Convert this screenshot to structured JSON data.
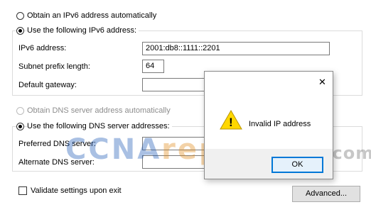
{
  "ipv6": {
    "auto_label": "Obtain an IPv6 address automatically",
    "manual_label": "Use the following IPv6 address:",
    "address_label": "IPv6 address:",
    "address_value": "2001:db8::1111::2201",
    "prefix_label": "Subnet prefix length:",
    "prefix_value": "64",
    "gateway_label": "Default gateway:",
    "gateway_value": ""
  },
  "dns": {
    "auto_label": "Obtain DNS server address automatically",
    "manual_label": "Use the following DNS server addresses:",
    "preferred_label": "Preferred DNS server:",
    "preferred_value": "",
    "alternate_label": "Alternate DNS server:",
    "alternate_value": ""
  },
  "validate_label": "Validate settings upon exit",
  "advanced_label": "Advanced...",
  "dialog": {
    "message": "Invalid IP address",
    "ok_label": "OK",
    "close_glyph": "✕",
    "warning_glyph": "!"
  },
  "watermark": {
    "part1": "CCNA",
    "part2": "reponses",
    "part3": ".com"
  },
  "colors": {
    "focus_blue": "#0078d7",
    "warning_yellow": "#ffd700"
  }
}
